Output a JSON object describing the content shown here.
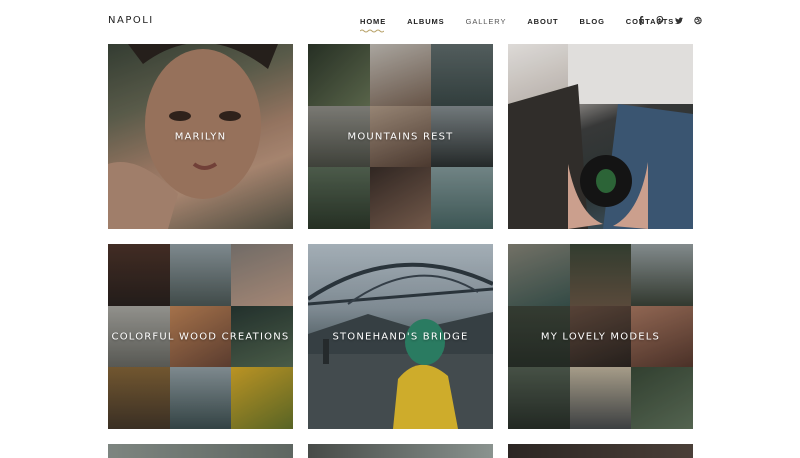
{
  "site": {
    "logo": "NAPOLI"
  },
  "nav": {
    "items": [
      {
        "label": "HOME"
      },
      {
        "label": "ALBUMS"
      },
      {
        "label": "GALLERY"
      },
      {
        "label": "ABOUT"
      },
      {
        "label": "BLOG"
      },
      {
        "label": "CONTACTS"
      }
    ],
    "active_underline_color": "#b8a36a"
  },
  "social": [
    "facebook-icon",
    "pinterest-icon",
    "twitter-icon",
    "dribbble-icon"
  ],
  "albums": [
    {
      "title": "MARILYN"
    },
    {
      "title": "MOUNTAINS REST"
    },
    {
      "title": ""
    },
    {
      "title": "COLORFUL WOOD CREATIONS"
    },
    {
      "title": "STONEHAND'S BRIDGE"
    },
    {
      "title": "MY LOVELY MODELS"
    }
  ]
}
